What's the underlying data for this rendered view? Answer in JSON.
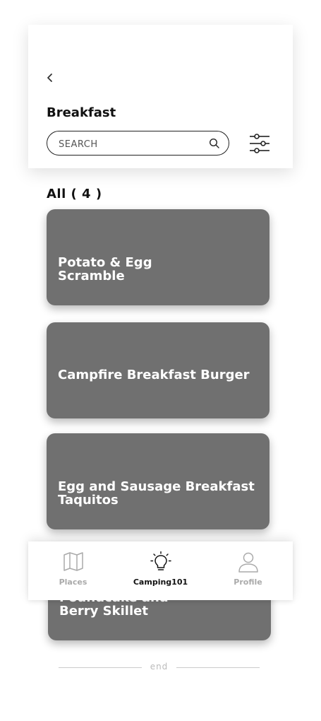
{
  "header": {
    "title": "Breakfast",
    "back_icon": "chevron-left-icon",
    "search": {
      "placeholder": "SEARCH",
      "value": "",
      "icon": "search-icon"
    },
    "filter_icon": "sliders-icon"
  },
  "list": {
    "count_label": "All ( 4 )",
    "items": [
      {
        "title": "Potato & Egg Scramble"
      },
      {
        "title": "Campfire Breakfast Burger"
      },
      {
        "title": "Egg and Sausage Breakfast Taquitos"
      },
      {
        "title": "Poundcake and Berry Skillet"
      }
    ],
    "end_label": "end"
  },
  "tabbar": {
    "tabs": [
      {
        "label": "Places",
        "icon": "map-icon",
        "active": false
      },
      {
        "label": "Camping101",
        "icon": "lightbulb-icon",
        "active": true
      },
      {
        "label": "Profile",
        "icon": "user-icon",
        "active": false
      }
    ]
  },
  "colors": {
    "card": "#707070",
    "active_tab": "#111111",
    "inactive_tab": "#aaaaaa"
  }
}
